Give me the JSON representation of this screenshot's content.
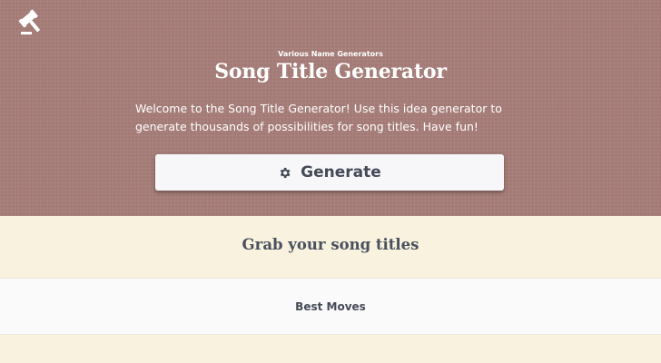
{
  "header": {
    "logo_icon": "gavel-icon",
    "subtitle": "Various Name Generators",
    "title": "Song Title Generator",
    "intro": "Welcome to the Song Title Generator! Use this idea generator to generate thousands of possibilities for song titles. Have fun!"
  },
  "generate_button": {
    "icon": "gear-icon",
    "label": "Generate"
  },
  "results": {
    "heading": "Grab your song titles",
    "items": [
      "Best Moves"
    ]
  },
  "colors": {
    "hero_bg": "#a37a75",
    "page_bg": "#f8f2de",
    "button_bg": "#f7f7f9",
    "text_dark": "#454a57"
  }
}
